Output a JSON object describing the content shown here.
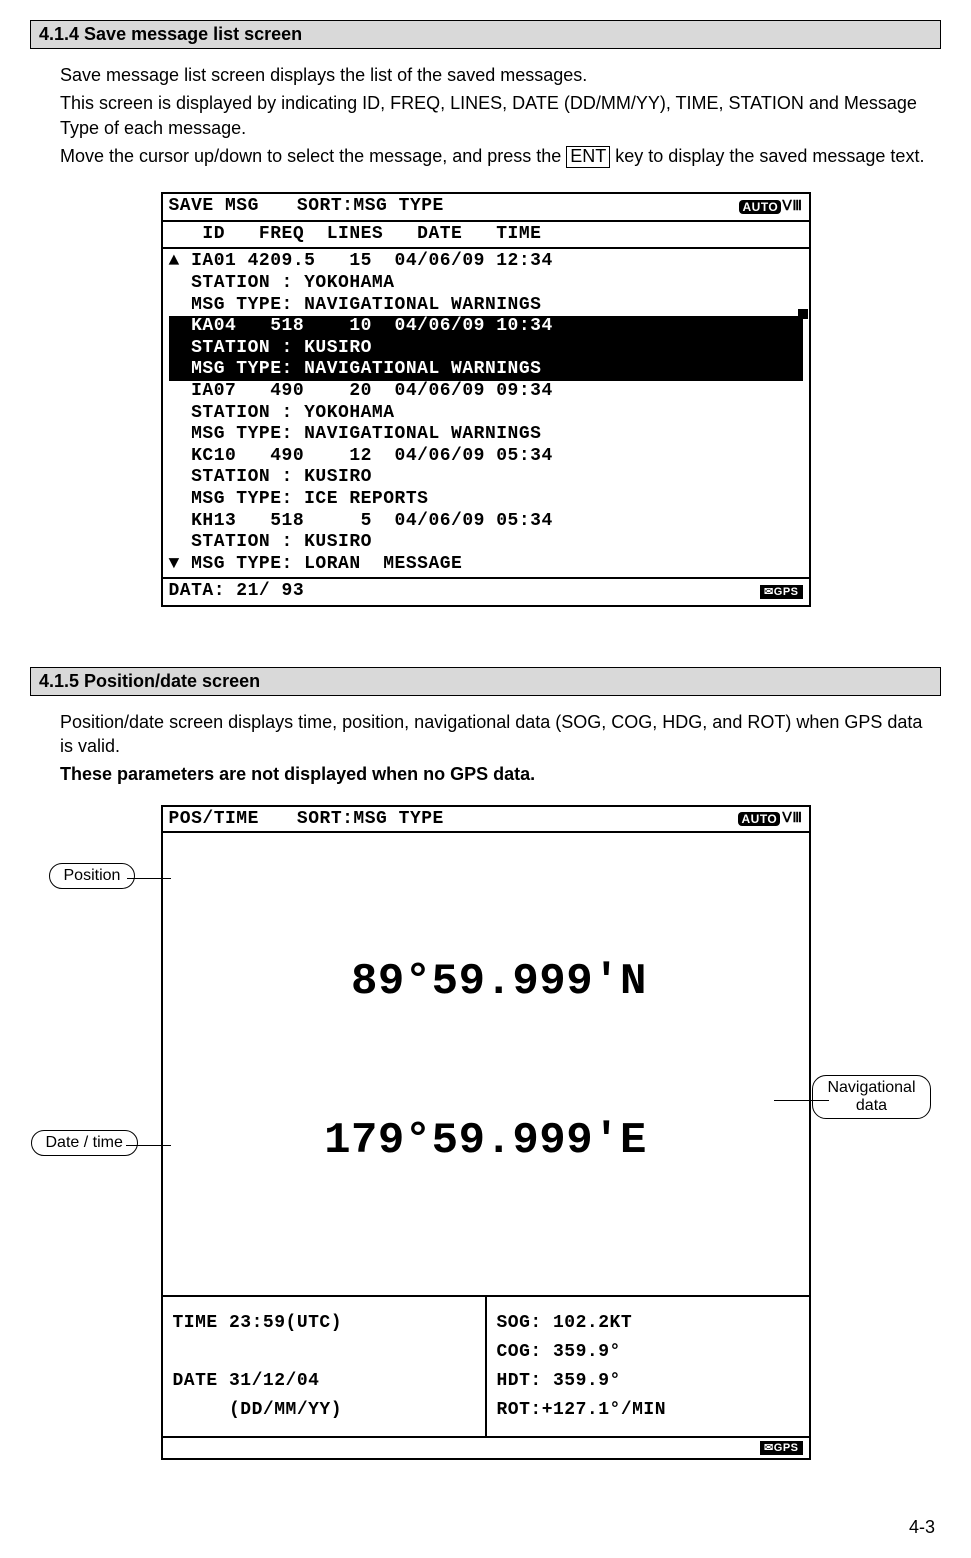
{
  "sections": {
    "s1": {
      "title": "4.1.4 Save message list screen",
      "p1": "Save message list screen displays the list of the saved messages.",
      "p2": "This screen is displayed by indicating ID, FREQ, LINES, DATE (DD/MM/YY), TIME, STATION and Message Type of each message.",
      "p3a": "Move the cursor up/down to select the message, and press the ",
      "key": "ENT",
      "p3b": " key to display the saved message text."
    },
    "s2": {
      "title": "4.1.5 Position/date screen",
      "p1": "Position/date screen displays time, position, navigational data (SOG, COG, HDG, and ROT) when GPS data is valid.",
      "p2": "These parameters are not displayed when no GPS data."
    }
  },
  "screen1": {
    "title": "SAVE MSG",
    "sort": "SORT:MSG TYPE",
    "auto": "AUTO",
    "mode": "ⅤⅢ",
    "columns": "   ID   FREQ  LINES   DATE   TIME",
    "rows": [
      {
        "l1": "  IA01 4209.5   15  04/06/09 12:34",
        "l2": "  STATION : YOKOHAMA",
        "l3": "  MSG TYPE: NAVIGATIONAL WARNINGS",
        "sel": false,
        "arrow_up": true
      },
      {
        "l1": "  KA04   518    10  04/06/09 10:34",
        "l2": "  STATION : KUSIRO",
        "l3": "  MSG TYPE: NAVIGATIONAL WARNINGS",
        "sel": true
      },
      {
        "l1": "  IA07   490    20  04/06/09 09:34",
        "l2": "  STATION : YOKOHAMA",
        "l3": "  MSG TYPE: NAVIGATIONAL WARNINGS",
        "sel": false
      },
      {
        "l1": "  KC10   490    12  04/06/09 05:34",
        "l2": "  STATION : KUSIRO",
        "l3": "  MSG TYPE: ICE REPORTS",
        "sel": false
      },
      {
        "l1": "  KH13   518     5  04/06/09 05:34",
        "l2": "  STATION : KUSIRO",
        "l3": "  MSG TYPE: LORAN  MESSAGE",
        "sel": false,
        "arrow_dn": true
      }
    ],
    "footer": "DATA: 21/ 93",
    "gps_badge": "✉GPS"
  },
  "screen2": {
    "title": "POS/TIME",
    "sort": "SORT:MSG TYPE",
    "auto": "AUTO",
    "mode": "ⅤⅢ",
    "pos_line1": " 89°59.999'N",
    "pos_line2": "179°59.999'E",
    "time": "TIME 23:59(UTC)",
    "date": "DATE 31/12/04",
    "date_fmt": "     (DD/MM/YY)",
    "sog": "SOG: 102.2KT",
    "cog": "COG: 359.9°",
    "hdt": "HDT: 359.9°",
    "rot": "ROT:+127.1°/MIN",
    "gps_badge": "✉GPS"
  },
  "callouts": {
    "position": "Position",
    "datetime": "Date / time",
    "navdata": "Navigational\ndata"
  },
  "page_num": "4-3",
  "chart_data": {
    "type": "table",
    "title": "Saved message list",
    "columns": [
      "ID",
      "FREQ",
      "LINES",
      "DATE",
      "TIME",
      "STATION",
      "MSG TYPE"
    ],
    "rows": [
      [
        "IA01",
        "4209.5",
        "15",
        "04/06/09",
        "12:34",
        "YOKOHAMA",
        "NAVIGATIONAL WARNINGS"
      ],
      [
        "KA04",
        "518",
        "10",
        "04/06/09",
        "10:34",
        "KUSIRO",
        "NAVIGATIONAL WARNINGS"
      ],
      [
        "IA07",
        "490",
        "20",
        "04/06/09",
        "09:34",
        "YOKOHAMA",
        "NAVIGATIONAL WARNINGS"
      ],
      [
        "KC10",
        "490",
        "12",
        "04/06/09",
        "05:34",
        "KUSIRO",
        "ICE REPORTS"
      ],
      [
        "KH13",
        "518",
        "5",
        "04/06/09",
        "05:34",
        "KUSIRO",
        "LORAN MESSAGE"
      ]
    ]
  }
}
